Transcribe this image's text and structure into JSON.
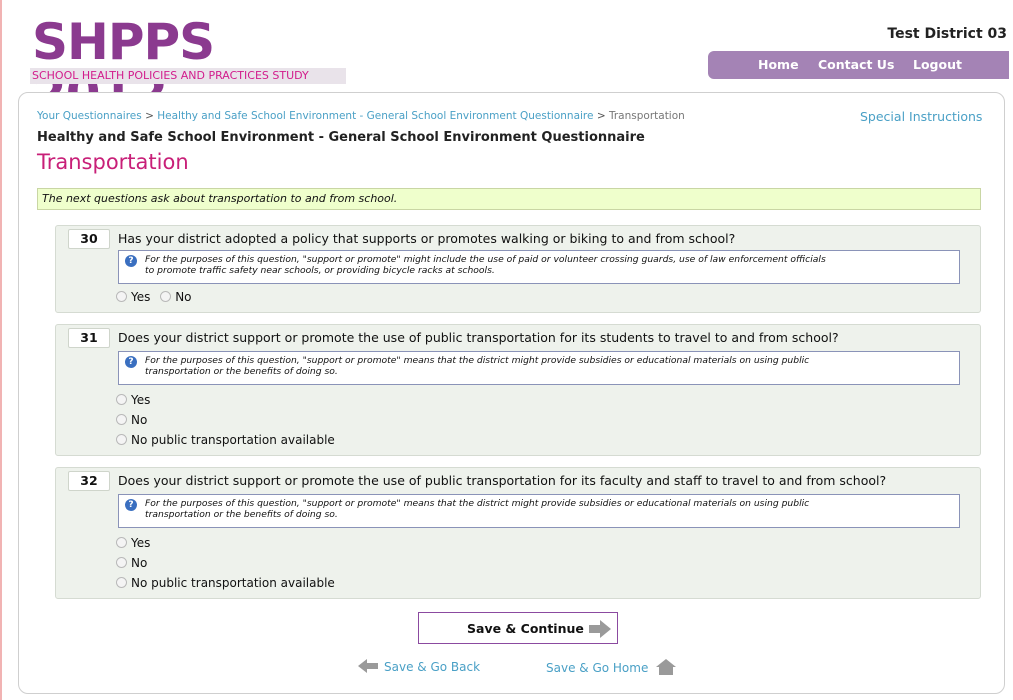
{
  "header": {
    "logo_title": "SHPPS 2012",
    "logo_subtitle": "SCHOOL HEALTH POLICIES AND PRACTICES STUDY",
    "district": "Test District 03",
    "nav": {
      "home": "Home",
      "contact": "Contact Us",
      "logout": "Logout"
    }
  },
  "breadcrumb": {
    "items": [
      "Your Questionnaires",
      "Healthy and Safe School Environment - General School Environment Questionnaire",
      "Transportation"
    ],
    "separator": ">"
  },
  "special_instructions": "Special Instructions",
  "questionnaire_title": "Healthy and Safe School Environment - General School Environment Questionnaire",
  "section_title": "Transportation",
  "intro": "The next questions ask about transportation to and from school.",
  "questions": [
    {
      "number": "30",
      "text": "Has your district adopted a policy that supports or promotes walking or biking to and from school?",
      "note_line1": "For the purposes of this question, \"support or promote\" might include the use of paid or volunteer crossing guards, use of law enforcement officials",
      "note_line2": "to promote traffic safety near schools, or providing bicycle racks at schools.",
      "options": [
        "Yes",
        "No"
      ]
    },
    {
      "number": "31",
      "text": "Does your district support or promote the use of public transportation for its students to travel to and from school?",
      "note_line1": "For the purposes of this question, \"support or promote\" means that the district might provide subsidies or educational materials on using public",
      "note_line2": "transportation or the benefits of doing so.",
      "options": [
        "Yes",
        "No",
        "No public transportation available"
      ]
    },
    {
      "number": "32",
      "text": "Does your district support or promote the use of public transportation for its faculty and staff to travel to and from school?",
      "note_line1": "For the purposes of this question, \"support or promote\" means that the district might provide subsidies or educational materials on using public",
      "note_line2": "transportation or the benefits of doing so.",
      "options": [
        "Yes",
        "No",
        "No public transportation available"
      ]
    }
  ],
  "buttons": {
    "save_continue": "Save & Continue",
    "save_back": "Save & Go Back",
    "save_home": "Save & Go Home"
  },
  "colors": {
    "brand_purple": "#8b3a8f",
    "nav_bg": "#a483b5",
    "section_pink": "#c81f78",
    "link_blue": "#4aa0c6",
    "intro_bg": "#efffcc",
    "question_bg": "#eef2ec"
  },
  "icons": {
    "info": "info-circle-icon",
    "arrow_right": "arrow-right-icon",
    "arrow_left": "arrow-left-icon",
    "home": "home-icon"
  }
}
